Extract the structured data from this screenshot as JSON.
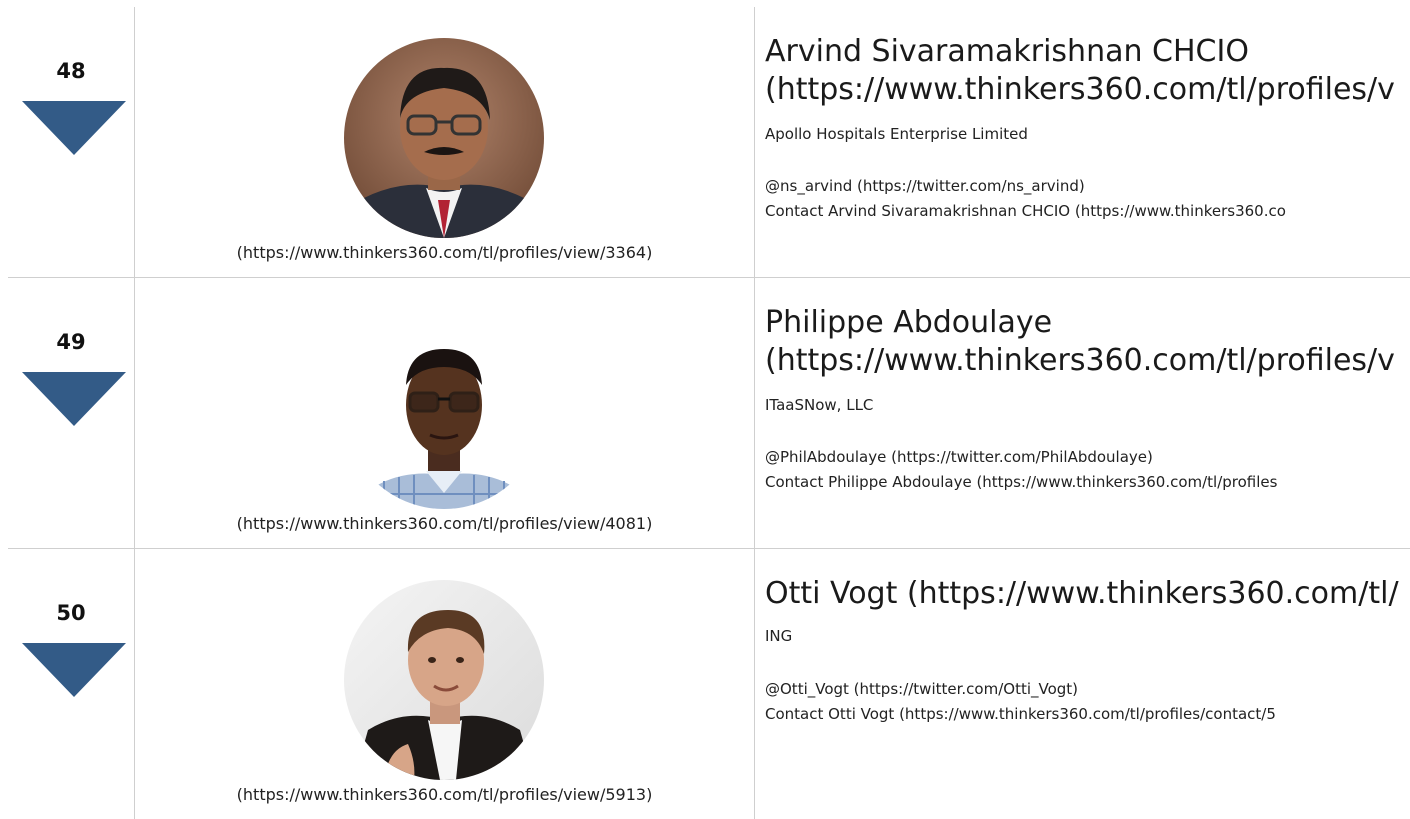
{
  "rows": [
    {
      "rank": "48",
      "photo_link": "(https://www.thinkers360.com/tl/profiles/view/3364)",
      "name_line1": "Arvind Sivaramakrishnan CHCIO",
      "name_line2": "(https://www.thinkers360.com/tl/profiles/v",
      "company": "Apollo Hospitals Enterprise Limited",
      "twitter": "@ns_arvind (https://twitter.com/ns_arvind)",
      "contact": "Contact Arvind Sivaramakrishnan CHCIO (https://www.thinkers360.co"
    },
    {
      "rank": "49",
      "photo_link": "(https://www.thinkers360.com/tl/profiles/view/4081)",
      "name_line1": "Philippe Abdoulaye",
      "name_line2": "(https://www.thinkers360.com/tl/profiles/v",
      "company": "ITaaSNow, LLC",
      "twitter": "@PhilAbdoulaye (https://twitter.com/PhilAbdoulaye)",
      "contact": "Contact Philippe Abdoulaye (https://www.thinkers360.com/tl/profiles"
    },
    {
      "rank": "50",
      "photo_link": "(https://www.thinkers360.com/tl/profiles/view/5913)",
      "name_line1": "Otti Vogt (https://www.thinkers360.com/tl/",
      "name_line2": "",
      "company": "ING",
      "twitter": "@Otti_Vogt (https://twitter.com/Otti_Vogt)",
      "contact": "Contact Otti Vogt (https://www.thinkers360.com/tl/profiles/contact/5"
    }
  ],
  "colors": {
    "rank_arrow": "#335b87",
    "grid_line": "#cfcfcf"
  },
  "icons": {
    "rank_arrow": "rank-down-arrow-icon"
  }
}
